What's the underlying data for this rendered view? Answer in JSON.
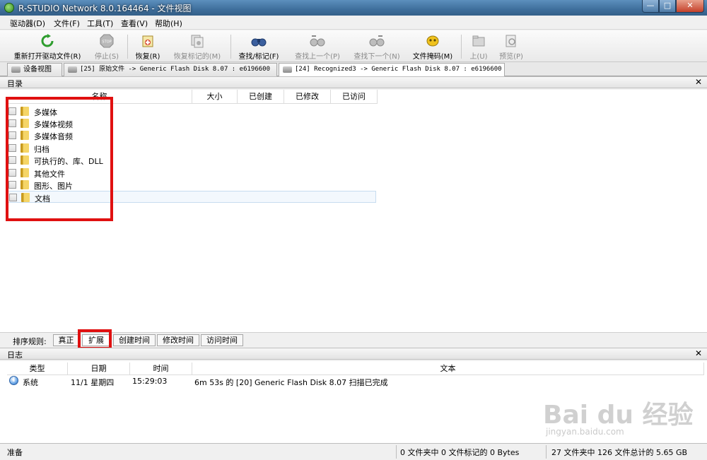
{
  "window": {
    "title": "R-STUDIO Network 8.0.164464 - 文件视图"
  },
  "window_controls": {
    "minimize": "—",
    "maximize": "□",
    "close": "✕"
  },
  "menu": [
    "驱动器(D)",
    "文件(F)",
    "工具(T)",
    "查看(V)",
    "帮助(H)"
  ],
  "toolbar": [
    {
      "label": "重新打开驱动文件(R)",
      "icon": "reopen-icon",
      "enabled": true
    },
    {
      "label": "停止(S)",
      "icon": "stop-icon",
      "enabled": false
    },
    {
      "label": "恢复(R)",
      "icon": "recover-icon",
      "enabled": true
    },
    {
      "label": "恢复标记的(M)",
      "icon": "recover-marked-icon",
      "enabled": false
    },
    {
      "label": "查找/标记(F)",
      "icon": "binoculars-icon",
      "enabled": true
    },
    {
      "label": "查找上一个(P)",
      "icon": "find-prev-icon",
      "enabled": false
    },
    {
      "label": "查找下一个(N)",
      "icon": "find-next-icon",
      "enabled": false
    },
    {
      "label": "文件掩码(M)",
      "icon": "file-mask-icon",
      "enabled": true
    },
    {
      "label": "上(U)",
      "icon": "up-icon",
      "enabled": false
    },
    {
      "label": "预览(P)",
      "icon": "preview-icon",
      "enabled": false
    }
  ],
  "tabs": [
    {
      "label": "设备视图",
      "active": false
    },
    {
      "label": "[25] 原始文件 -> Generic Flash Disk 8.07 : e6196600",
      "active": false
    },
    {
      "label": "[24] Recognized3 -> Generic Flash Disk 8.07 : e6196600",
      "active": true
    }
  ],
  "directory": {
    "title": "目录",
    "close": "✕",
    "columns": [
      "名称",
      "大小",
      "已创建",
      "已修改",
      "已访问"
    ],
    "items": [
      "多媒体",
      "多媒体视频",
      "多媒体音频",
      "归档",
      "可执行的、库、DLL",
      "其他文件",
      "图形、图片",
      "文档"
    ]
  },
  "sort": {
    "label": "排序规则:",
    "options": [
      "真正",
      "扩展",
      "创建时间",
      "修改时间",
      "访问时间"
    ],
    "active_index": 1
  },
  "log": {
    "title": "日志",
    "close": "✕",
    "columns": [
      "类型",
      "日期",
      "时间",
      "文本"
    ],
    "rows": [
      {
        "type": "系统",
        "date": "11/1 星期四",
        "time": "15:29:03",
        "text": "6m 53s 的 [20] Generic Flash Disk 8.07 扫描已完成"
      }
    ]
  },
  "watermark": {
    "text": "Bai du 经验",
    "sub": "jingyan.baidu.com"
  },
  "status": {
    "ready": "准备",
    "marked": "0 文件夹中 0 文件标记的 0 Bytes",
    "total": "27 文件夹中 126 文件总计的 5.65 GB"
  },
  "colors": {
    "highlight": "#e01010",
    "titlebar": "#3f6f9c"
  }
}
